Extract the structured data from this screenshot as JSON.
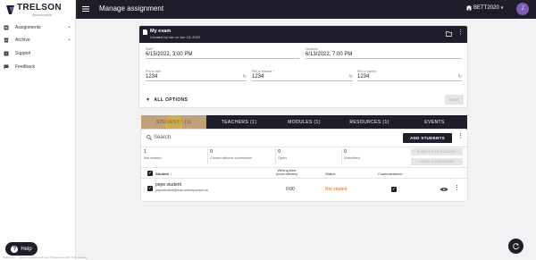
{
  "app": {
    "logo_name": "TRELSON",
    "logo_tagline": "Assessment",
    "page_title": "Manage assignment",
    "school": "BETT2020",
    "user_initial": "J"
  },
  "sidebar": {
    "items": [
      {
        "label": "Assignments",
        "icon": "assignment-icon",
        "expandable": true
      },
      {
        "label": "Archive",
        "icon": "archive-icon",
        "expandable": true
      },
      {
        "label": "Support",
        "icon": "support-icon",
        "expandable": false
      },
      {
        "label": "Feedback",
        "icon": "feedback-icon",
        "expandable": false
      }
    ],
    "help_label": "Help"
  },
  "status_bar": "Waiting for ... (trelson assessment eval 730.dev.test.utbm 5 2x. testers)",
  "exam": {
    "title": "My exam",
    "created": "Created by me on Jun 15, 2022",
    "start_label": "Start*",
    "start_value": "6/15/2022, 3:00 PM",
    "deadline_label": "Deadline",
    "deadline_value": "6/13/2022, 7:00 PM",
    "pin_start_label": "PIN to start",
    "pin_start_value": "1234",
    "pin_resume_label": "PIN to resume *",
    "pin_resume_value": "1234",
    "pin_submit_label": "PIN to submit",
    "pin_submit_value": "1234",
    "all_options_label": "ALL OPTIONS",
    "save_label": "SAVE"
  },
  "tabs": [
    {
      "label": "STUDENTS (1)",
      "active": true
    },
    {
      "label": "TEACHERS (1)",
      "active": false
    },
    {
      "label": "MODULES (1)",
      "active": false
    },
    {
      "label": "RESOURCES (1)",
      "active": false
    },
    {
      "label": "EVENTS",
      "active": false
    }
  ],
  "students": {
    "search_placeholder": "Search",
    "add_button": "ADD STUDENTS",
    "stats": [
      {
        "value": "1",
        "label": "Not started"
      },
      {
        "value": "0",
        "label": "Closed without submission"
      },
      {
        "value": "0",
        "label": "Open"
      },
      {
        "value": "0",
        "label": "Submitted"
      }
    ],
    "submit_for_student": "SUBMIT FOR STUDENT",
    "undo_submission": "UNDO SUBMISSION",
    "columns": {
      "student": "Student",
      "writing_time": "Writing time",
      "writing_time_unit": "(hours:minutes)",
      "status": "Status",
      "customizations": "Customizations"
    },
    "rows": [
      {
        "name": "pepe student",
        "email": "pepestudent@edu.onlinepartner.se",
        "writing_time": "0:00",
        "status": "Not started"
      }
    ]
  },
  "colors": {
    "brand_dark": "#1e1e2a",
    "status_not_started": "#e06a1c",
    "active_tab": "#c0a27a"
  }
}
